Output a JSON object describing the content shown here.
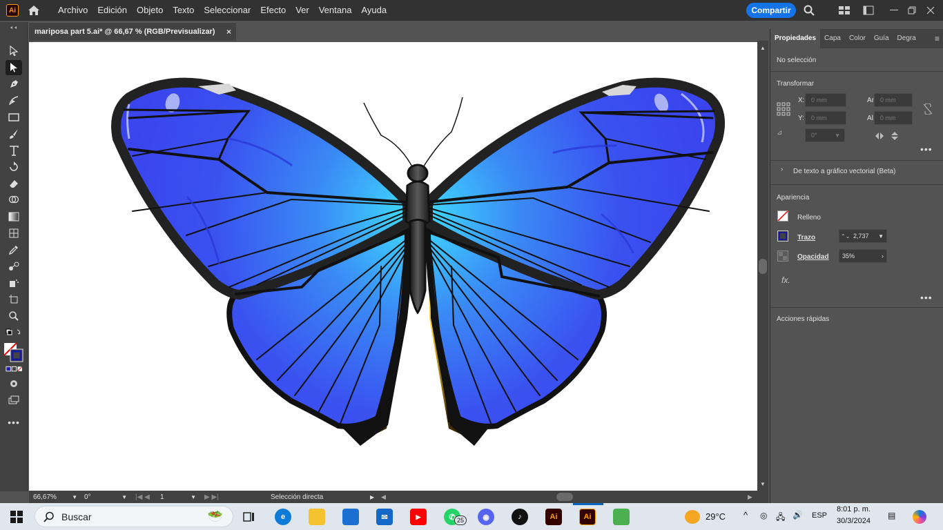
{
  "app": {
    "logo_text": "Ai"
  },
  "menu": [
    "Archivo",
    "Edición",
    "Objeto",
    "Texto",
    "Seleccionar",
    "Efecto",
    "Ver",
    "Ventana",
    "Ayuda"
  ],
  "share_label": "Compartir",
  "document": {
    "tab_title": "mariposa part 5.ai* @ 66,67 % (RGB/Previsualizar)",
    "close_glyph": "×"
  },
  "status": {
    "zoom": "66,67%",
    "rotation": "0°",
    "artboard": "1",
    "tool": "Selección directa"
  },
  "panel": {
    "tabs": [
      "Propiedades",
      "Capa",
      "Color",
      "Guía",
      "Degra"
    ],
    "no_selection": "No selección",
    "transform": {
      "title": "Transformar",
      "x_label": "X:",
      "y_label": "Y:",
      "w_label": "An.:",
      "h_label": "Al.:",
      "x_value": "0 mm",
      "y_value": "0 mm",
      "w_value": "0 mm",
      "h_value": "0 mm",
      "angle_value": "0°"
    },
    "vectorize": "De texto a gráfico vectorial (Beta)",
    "appearance": {
      "title": "Apariencia",
      "fill_label": "Relleno",
      "stroke_label": "Trazo",
      "stroke_value": "2,737",
      "opacity_label": "Opacidad",
      "opacity_value": "35%",
      "fx_label": "fx."
    },
    "quick_actions": "Acciones rápidas"
  },
  "taskbar": {
    "search_placeholder": "Buscar",
    "whatsapp_badge": "25",
    "weather": "29°C",
    "language": "ESP",
    "time": "8:01 p. m.",
    "date": "30/3/2024",
    "ai_label": "Ai"
  },
  "colors": {
    "accent": "#1473e6",
    "wing_blue": "#3a4ef0",
    "wing_center": "#3fd3ff",
    "body_yellow": "#ffd21a"
  }
}
